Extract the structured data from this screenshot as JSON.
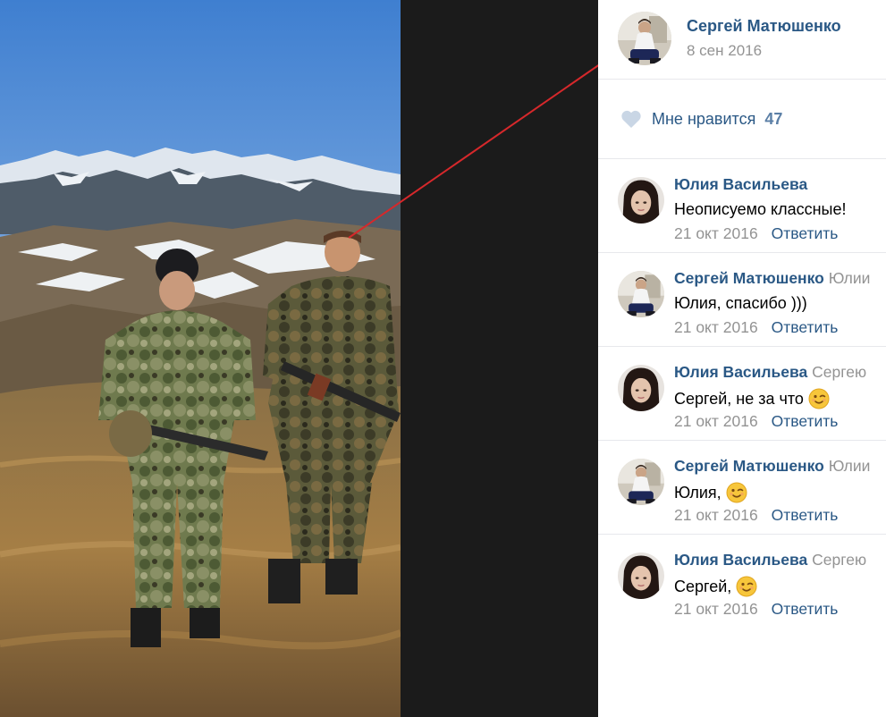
{
  "post": {
    "author": "Сергей Матюшенко",
    "date": "8 сен 2016"
  },
  "likes": {
    "label": "Мне нравится",
    "count": "47",
    "icon": "heart-icon"
  },
  "comments": [
    {
      "author": "Юлия Васильева",
      "reply_to": "",
      "text": "Неописуемо классные!",
      "emoji": "",
      "date": "21 окт 2016",
      "reply_label": "Ответить"
    },
    {
      "author": "Сергей Матюшенко",
      "reply_to": "Юлии",
      "text": "Юлия, спасибо )))",
      "emoji": "",
      "date": "21 окт 2016",
      "reply_label": "Ответить"
    },
    {
      "author": "Юлия Васильева",
      "reply_to": "Сергею",
      "text": "Сергей, не за что",
      "emoji": "wink-emoji",
      "date": "21 окт 2016",
      "reply_label": "Ответить"
    },
    {
      "author": "Сергей Матюшенко",
      "reply_to": "Юлии",
      "text": "Юлия,",
      "emoji": "wink-emoji",
      "date": "21 окт 2016",
      "reply_label": "Ответить"
    },
    {
      "author": "Юлия Васильева",
      "reply_to": "Сергею",
      "text": "Сергей,",
      "emoji": "wink-emoji",
      "date": "21 окт 2016",
      "reply_label": "Ответить"
    }
  ],
  "colors": {
    "link": "#2a5885",
    "muted": "#939393",
    "divider": "#e7e8ec",
    "annotation_line": "#d6282b",
    "photo_backdrop": "#1b1b1b"
  }
}
